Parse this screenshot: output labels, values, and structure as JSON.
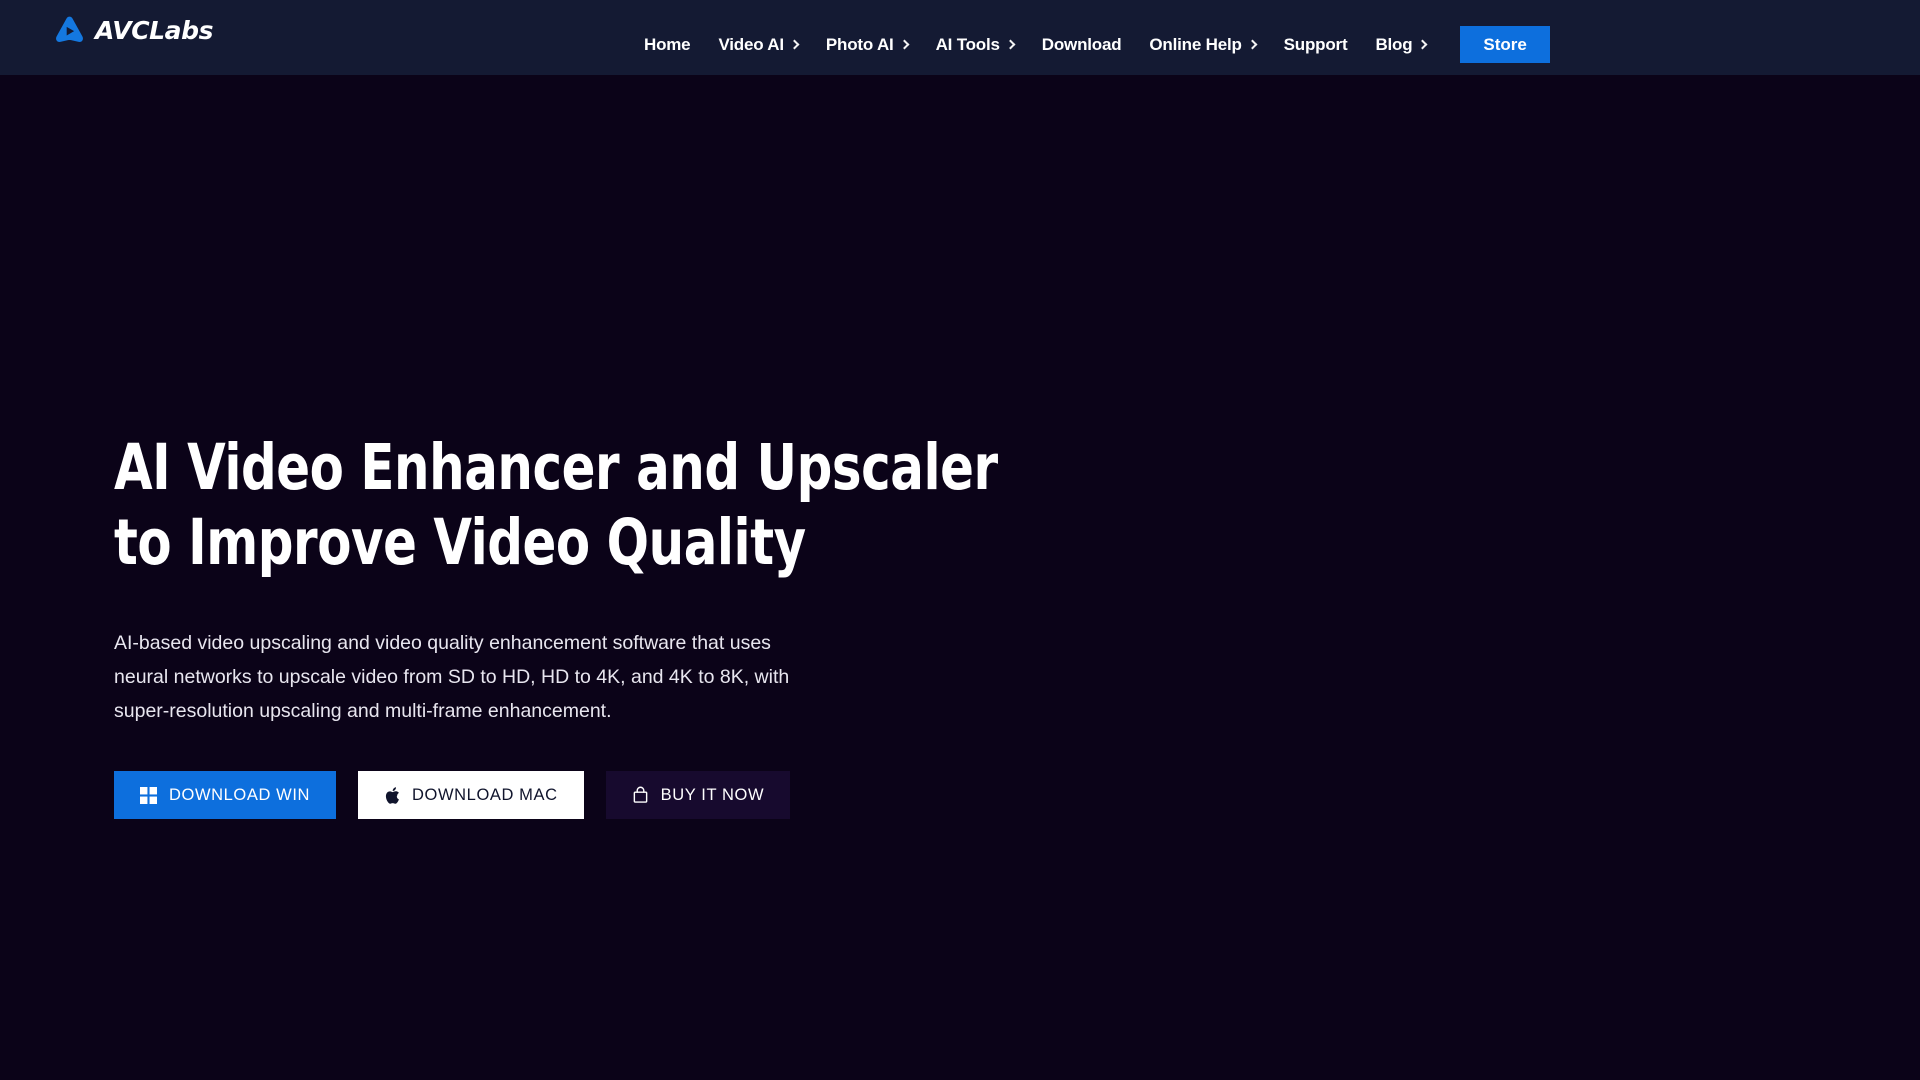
{
  "brand": {
    "name": "AVCLabs",
    "logo_icon": "avclabs-triangle-play-logo",
    "logo_color": "#1478e0"
  },
  "header": {
    "background_color": "#141a33",
    "nav": [
      {
        "label": "Home",
        "has_dropdown": false
      },
      {
        "label": "Video AI",
        "has_dropdown": true
      },
      {
        "label": "Photo AI",
        "has_dropdown": true
      },
      {
        "label": "AI Tools",
        "has_dropdown": true
      },
      {
        "label": "Download",
        "has_dropdown": false
      },
      {
        "label": "Online Help",
        "has_dropdown": true
      },
      {
        "label": "Support",
        "has_dropdown": false
      },
      {
        "label": "Blog",
        "has_dropdown": true
      }
    ],
    "store_button": {
      "label": "Store",
      "background_color": "#0d6fdd",
      "text_color": "#ffffff"
    }
  },
  "hero": {
    "background_color": "#0b0318",
    "title_line1": "AI Video Enhancer and Upscaler",
    "title_line2": "to Improve Video Quality",
    "description": "AI-based video upscaling and video quality enhancement software that uses neural networks to upscale video from SD to HD, HD to 4K, and 4K to 8K, with super-resolution upscaling and multi-frame enhancement.",
    "buttons": [
      {
        "label": "DOWNLOAD WIN",
        "icon": "windows-logo-icon",
        "background_color": "#0d6fdd",
        "text_color": "#ffffff"
      },
      {
        "label": "DOWNLOAD MAC",
        "icon": "apple-logo-icon",
        "background_color": "#ffffff",
        "text_color": "#10142c"
      },
      {
        "label": "BUY IT NOW",
        "icon": "shopping-bag-icon",
        "background_color": "#170a2e",
        "text_color": "#ffffff"
      }
    ]
  }
}
